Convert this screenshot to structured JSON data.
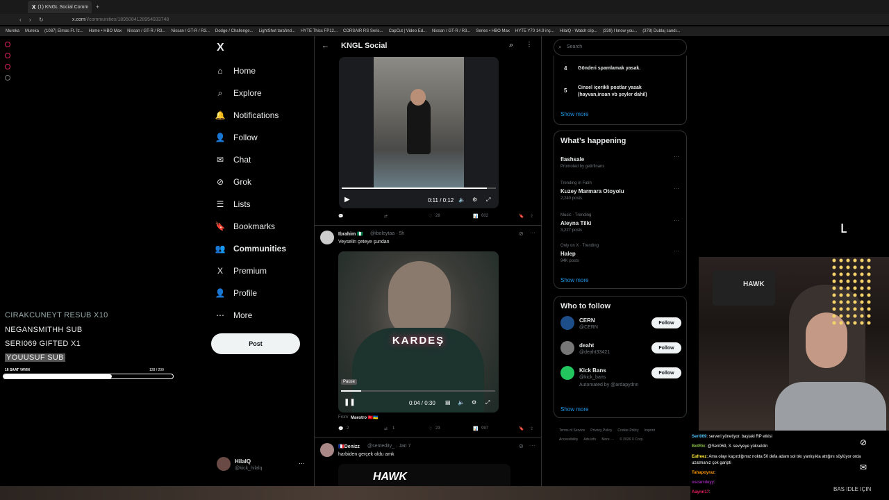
{
  "browser": {
    "tab_title": "(1) KNGL Social Comm",
    "url_prefix": "x.com",
    "url": "/i/communities/1895084128954933748",
    "bookmarks": [
      "Mureka",
      "Mureka",
      "(1087) Elmas Ft. İz...",
      "Home • HBO Max",
      "Nissan / GT-R / R3...",
      "Nissan / GT-R / R3...",
      "Dodge / Challenge...",
      "LightShot tarafınd...",
      "HYTE Thicc FP12...",
      "CORSAIR RS Seris...",
      "CapCut | Video Ed...",
      "Nissan / GT-R / R3...",
      "Series • HBO Max",
      "HYTE Y70 14.9 inç...",
      "HilalQ - Watch clip...",
      "(339) I know you...",
      "(378) Dublaj sandı..."
    ]
  },
  "nav": {
    "logo": "X",
    "items": [
      {
        "label": "Home",
        "icon": "home-icon",
        "glyph": "⌂"
      },
      {
        "label": "Explore",
        "icon": "search-icon",
        "glyph": "⌕"
      },
      {
        "label": "Notifications",
        "icon": "bell-icon",
        "glyph": "🔔"
      },
      {
        "label": "Follow",
        "icon": "person-add-icon",
        "glyph": "👤"
      },
      {
        "label": "Chat",
        "icon": "mail-icon",
        "glyph": "✉"
      },
      {
        "label": "Grok",
        "icon": "grok-icon",
        "glyph": "⊘"
      },
      {
        "label": "Lists",
        "icon": "list-icon",
        "glyph": "☰"
      },
      {
        "label": "Bookmarks",
        "icon": "bookmark-icon",
        "glyph": "🔖"
      },
      {
        "label": "Communities",
        "icon": "communities-icon",
        "glyph": "👥"
      },
      {
        "label": "Premium",
        "icon": "x-premium-icon",
        "glyph": "X"
      },
      {
        "label": "Profile",
        "icon": "profile-icon",
        "glyph": "👤"
      },
      {
        "label": "More",
        "icon": "more-circle-icon",
        "glyph": "⋯"
      }
    ],
    "post": "Post",
    "account": {
      "name": "HilalQ",
      "handle": "@kick_hilalq"
    }
  },
  "feed": {
    "title": "KNGL Social",
    "video1": {
      "time": "0:11 / 0:12",
      "stats": {
        "likes": "28",
        "views": "602"
      }
    },
    "tweet2": {
      "name": "Ibrahim 🇳🇬",
      "handle": "@iboleytaa · 5h",
      "text": "Veyselin çeteye şundan",
      "overlay_text": "KARDEŞ",
      "pause_label": "Pause",
      "time": "0:04 / 0:30",
      "from_label": "From",
      "from_name": "Maestro 🇹🇷🇺🇦",
      "stats": {
        "replies": "2",
        "reposts": "1",
        "likes": "23",
        "views": "997"
      }
    },
    "tweet3": {
      "name": "🇫🇷Denizz",
      "handle": "@sentedity_ · Jan 7",
      "text": "harbiden gerçek oldu amk"
    }
  },
  "right": {
    "search_placeholder": "Search",
    "rules": [
      {
        "n": "4",
        "text": "Gönderi spamlamak yasak."
      },
      {
        "n": "5",
        "text": "Cinsel içerikli postlar yasak (hayvan,insan vb şeyler dahil)"
      }
    ],
    "show_more": "Show more",
    "happening_title": "What’s happening",
    "trends": [
      {
        "ctx": "",
        "name": "flashsale",
        "meta": "Promoted by getirfinans"
      },
      {
        "ctx": "Trending in Fatih",
        "name": "Kuzey Marmara Otoyolu",
        "meta": "2,240 posts"
      },
      {
        "ctx": "Music · Trending",
        "name": "Aleyna Tilki",
        "meta": "3,227 posts"
      },
      {
        "ctx": "Only on X · Trending",
        "name": "Halep",
        "meta": "94K posts"
      }
    ],
    "who_title": "Who to follow",
    "follow": [
      {
        "name": "CERN",
        "handle": "@CERN",
        "extra": ""
      },
      {
        "name": "deaht",
        "handle": "@deaht33421",
        "extra": ""
      },
      {
        "name": "Kick Bans",
        "handle": "@kick_bans",
        "extra": "Automated by @ardapydnn"
      }
    ],
    "follow_label": "Follow",
    "footer": [
      "Terms of Service",
      "Privacy Policy",
      "Cookie Policy",
      "Imprint",
      "Accessibility",
      "Ads info",
      "More ···",
      "© 2026 X Corp."
    ]
  },
  "overlay": {
    "events": [
      "CIRAKCUNEYT  RESUB X10",
      "NEGANSMITHH  SUB",
      "SERI069  GIFTED X1",
      "YOUUSUF  SUB"
    ],
    "progress_label": "16 SAAT YAYIN",
    "progress_count": "128 / 200",
    "progress_fraction": 0.64
  },
  "chat": [
    {
      "user": "Seri069",
      "text": ": serveri yönetiyor. baştaki RP etkisi",
      "color": "#4fc3f7"
    },
    {
      "user": "BotRix",
      "text": ": @Seri069, 3. seviyeye yükseldin",
      "color": "#8bc34a"
    },
    {
      "user": "Eafreez",
      "text": ": Ama olayı kaçırdığımız nokta 50 defa adam sol tıkı yanlışıkla attığını söylüyor orda uzatmanız çok garipti",
      "color": "#ffeb3b"
    },
    {
      "user": "Tahapoyraz",
      "text": ":",
      "color": "#ff9800"
    },
    {
      "user": "oscarrdeyy",
      "text": ": ",
      "color": "#9c27b0"
    },
    {
      "user": "Aaynn17",
      "text": ": ",
      "color": "#e91e63"
    }
  ],
  "stream_badge": "BAS IDLE IÇIN"
}
